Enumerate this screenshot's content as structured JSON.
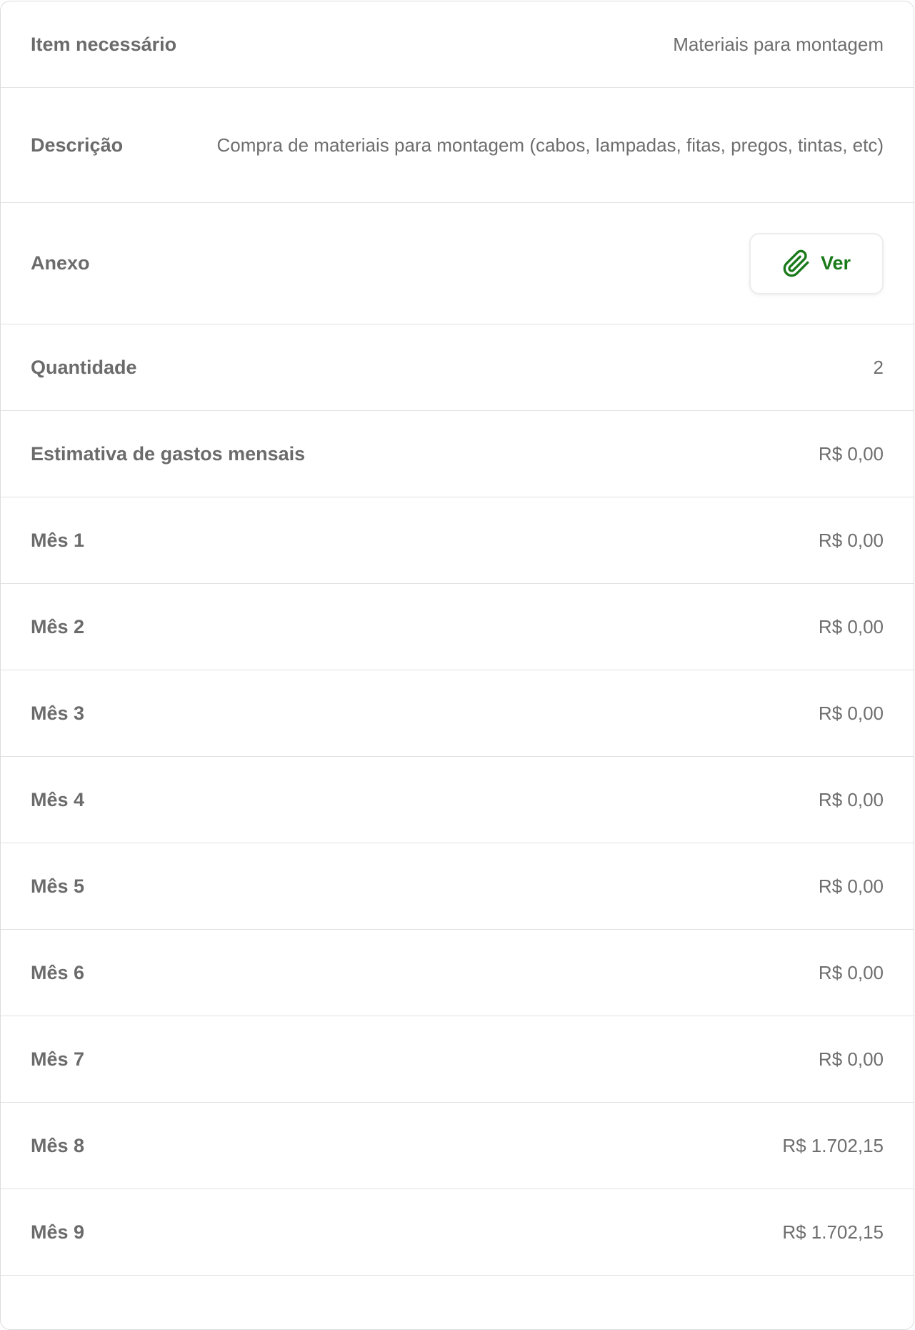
{
  "colors": {
    "accent_green": "#1a7a1a",
    "label_gray": "#6b6b6b",
    "value_gray": "#6e6e6e",
    "divider": "#e2e2e2"
  },
  "rows": {
    "item": {
      "label": "Item necessário",
      "value": "Materiais para montagem"
    },
    "descricao": {
      "label": "Descrição",
      "value": "Compra de materiais para montagem (cabos, lampadas, fitas, pregos, tintas, etc)"
    },
    "anexo": {
      "label": "Anexo",
      "button_label": "Ver",
      "button_icon": "paperclip-icon"
    },
    "quantidade": {
      "label": "Quantidade",
      "value": "2"
    },
    "estimativa": {
      "label": "Estimativa de gastos mensais",
      "value": "R$ 0,00"
    },
    "months": [
      {
        "label": "Mês 1",
        "value": "R$ 0,00"
      },
      {
        "label": "Mês 2",
        "value": "R$ 0,00"
      },
      {
        "label": "Mês 3",
        "value": "R$ 0,00"
      },
      {
        "label": "Mês 4",
        "value": "R$ 0,00"
      },
      {
        "label": "Mês 5",
        "value": "R$ 0,00"
      },
      {
        "label": "Mês 6",
        "value": "R$ 0,00"
      },
      {
        "label": "Mês 7",
        "value": "R$ 0,00"
      },
      {
        "label": "Mês 8",
        "value": "R$ 1.702,15"
      },
      {
        "label": "Mês 9",
        "value": "R$ 1.702,15"
      }
    ]
  }
}
